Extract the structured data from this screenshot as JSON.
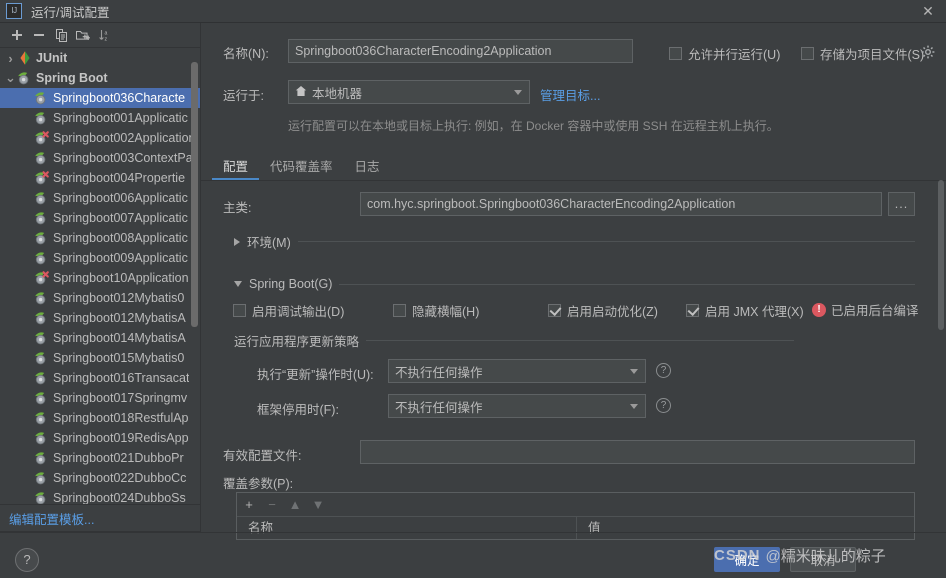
{
  "window": {
    "title": "运行/调试配置",
    "app_badge": "IJ",
    "close_icon": "✕"
  },
  "sidebar": {
    "toolbar": [
      {
        "name": "add-configuration-button",
        "icon": "plus-icon"
      },
      {
        "name": "remove-configuration-button",
        "icon": "minus-icon"
      },
      {
        "name": "copy-configuration-button",
        "icon": "copy-icon"
      },
      {
        "name": "move-into-folder-button",
        "icon": "folder-add-icon"
      },
      {
        "name": "sort-configurations-button",
        "icon": "sort-az-icon"
      }
    ],
    "tree": [
      {
        "label": "JUnit",
        "type": "group",
        "expanded": false,
        "icon": "junit-icon",
        "selected": false
      },
      {
        "label": "Spring Boot",
        "type": "group",
        "expanded": true,
        "icon": "springboot-icon",
        "selected": false
      },
      {
        "label": "Springboot036Characte",
        "type": "item",
        "icon": "springboot-icon",
        "selected": true,
        "error": false
      },
      {
        "label": "Springboot001Applicatic",
        "type": "item",
        "icon": "springboot-icon",
        "selected": false,
        "error": false
      },
      {
        "label": "Springboot002Application",
        "type": "item",
        "icon": "springboot-icon",
        "selected": false,
        "error": true
      },
      {
        "label": "Springboot003ContextPa",
        "type": "item",
        "icon": "springboot-icon",
        "selected": false,
        "error": false
      },
      {
        "label": "Springboot004Propertie",
        "type": "item",
        "icon": "springboot-icon",
        "selected": false,
        "error": true
      },
      {
        "label": "Springboot006Applicatic",
        "type": "item",
        "icon": "springboot-icon",
        "selected": false,
        "error": false
      },
      {
        "label": "Springboot007Applicatic",
        "type": "item",
        "icon": "springboot-icon",
        "selected": false,
        "error": false
      },
      {
        "label": "Springboot008Applicatic",
        "type": "item",
        "icon": "springboot-icon",
        "selected": false,
        "error": false
      },
      {
        "label": "Springboot009Applicatic",
        "type": "item",
        "icon": "springboot-icon",
        "selected": false,
        "error": false
      },
      {
        "label": "Springboot10Application",
        "type": "item",
        "icon": "springboot-icon",
        "selected": false,
        "error": true
      },
      {
        "label": "Springboot012Mybatis0",
        "type": "item",
        "icon": "springboot-icon",
        "selected": false,
        "error": false
      },
      {
        "label": "Springboot012MybatisA",
        "type": "item",
        "icon": "springboot-icon",
        "selected": false,
        "error": false
      },
      {
        "label": "Springboot014MybatisA",
        "type": "item",
        "icon": "springboot-icon",
        "selected": false,
        "error": false
      },
      {
        "label": "Springboot015Mybatis0",
        "type": "item",
        "icon": "springboot-icon",
        "selected": false,
        "error": false
      },
      {
        "label": "Springboot016Transacat",
        "type": "item",
        "icon": "springboot-icon",
        "selected": false,
        "error": false
      },
      {
        "label": "Springboot017Springmv",
        "type": "item",
        "icon": "springboot-icon",
        "selected": false,
        "error": false
      },
      {
        "label": "Springboot018RestfulAp",
        "type": "item",
        "icon": "springboot-icon",
        "selected": false,
        "error": false
      },
      {
        "label": "Springboot019RedisApp",
        "type": "item",
        "icon": "springboot-icon",
        "selected": false,
        "error": false
      },
      {
        "label": "Springboot021DubboPr",
        "type": "item",
        "icon": "springboot-icon",
        "selected": false,
        "error": false
      },
      {
        "label": "Springboot022DubboCc",
        "type": "item",
        "icon": "springboot-icon",
        "selected": false,
        "error": false
      },
      {
        "label": "Springboot024DubboSs",
        "type": "item",
        "icon": "springboot-icon",
        "selected": false,
        "error": false
      }
    ],
    "edit_templates_link": "编辑配置模板..."
  },
  "form": {
    "name_label": "名称(N):",
    "name_value": "Springboot036CharacterEncoding2Application",
    "allow_parallel_label": "允许并行运行(U)",
    "allow_parallel_checked": false,
    "store_as_project_file_label": "存储为项目文件(S)",
    "store_as_project_file_checked": false,
    "gear_icon": "gear-icon",
    "run_on_label": "运行于:",
    "run_on_value": "本地机器",
    "run_on_icon": "home-icon",
    "manage_targets_link": "管理目标...",
    "run_on_hint": "运行配置可以在本地或目标上执行: 例如，在 Docker 容器中或使用 SSH 在远程主机上执行。"
  },
  "tabs": [
    {
      "label": "配置",
      "active": true
    },
    {
      "label": "代码覆盖率",
      "active": false
    },
    {
      "label": "日志",
      "active": false
    }
  ],
  "configuration": {
    "main_class_label": "主类:",
    "main_class_value": "com.hyc.springboot.Springboot036CharacterEncoding2Application",
    "browse_button_label": "...",
    "environment_section": "环境(M)",
    "environment_expanded": false,
    "spring_boot_section": "Spring Boot(G)",
    "spring_boot_expanded": true,
    "checkboxes": [
      {
        "label": "启用调试输出(D)",
        "checked": false,
        "name": "enable-debug-output-checkbox"
      },
      {
        "label": "隐藏横幅(H)",
        "checked": false,
        "name": "hide-banner-checkbox"
      },
      {
        "label": "启用启动优化(Z)",
        "checked": true,
        "name": "enable-launch-optimization-checkbox"
      },
      {
        "label": "启用 JMX 代理(X)",
        "checked": true,
        "name": "enable-jmx-agent-checkbox"
      }
    ],
    "background_compile_warning": "已启用后台编译",
    "update_policy_section": "运行应用程序更新策略",
    "on_update_label": "执行“更新”操作时(U):",
    "on_update_value": "不执行任何操作",
    "on_frame_deactivate_label": "框架停用时(F):",
    "on_frame_deactivate_value": "不执行任何操作",
    "active_profiles_label": "有效配置文件:",
    "active_profiles_value": "",
    "override_params_label": "覆盖参数(P):",
    "params_table": {
      "toolbar": [
        "+",
        "−",
        "▲",
        "▼"
      ],
      "columns": [
        "名称",
        "值"
      ],
      "rows": []
    }
  },
  "footer": {
    "help_button": "?",
    "ok_button": "确定",
    "cancel_button": "取消",
    "watermark_brand": "CSDN",
    "watermark_user": "@糯米味儿的粽子"
  },
  "colors": {
    "background": "#3c3f41",
    "selection": "#4b6eaf",
    "link": "#5a9ee6",
    "field_bg": "#45494a",
    "error": "#db5860",
    "tab_accent": "#4a88c7"
  }
}
